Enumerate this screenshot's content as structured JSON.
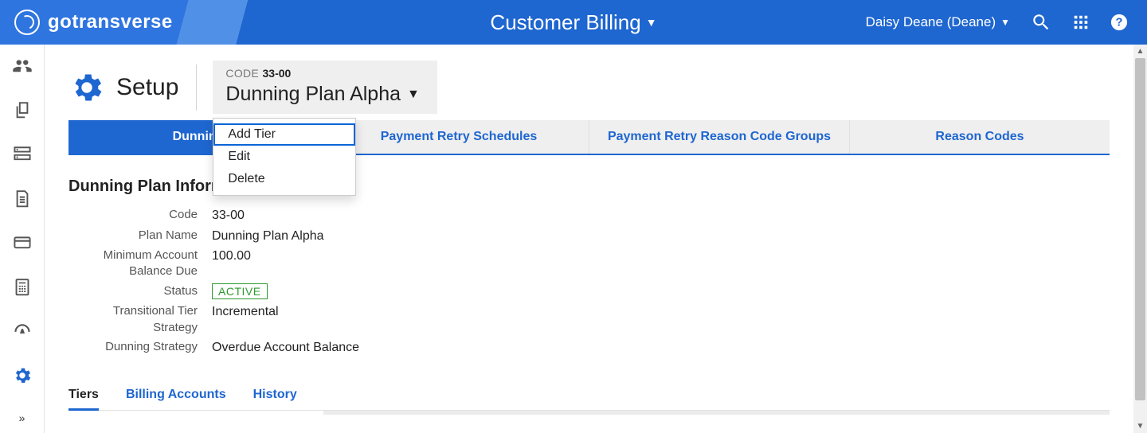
{
  "topbar": {
    "brand": "gotransverse",
    "module": "Customer Billing",
    "user": "Daisy Deane (Deane)"
  },
  "page": {
    "setup_label": "Setup",
    "code_label": "CODE",
    "code_value": "33-00",
    "plan_name": "Dunning Plan Alpha"
  },
  "plan_menu": {
    "add_tier": "Add Tier",
    "edit": "Edit",
    "delete": "Delete"
  },
  "top_tabs": {
    "dunning": "Dunning",
    "pay_retry_sched": "Payment Retry Schedules",
    "pay_retry_groups": "Payment Retry Reason Code Groups",
    "reason_codes": "Reason Codes"
  },
  "info_section": {
    "heading": "Dunning Plan Information",
    "rows": {
      "code": {
        "label": "Code",
        "value": "33-00"
      },
      "plan_name": {
        "label": "Plan Name",
        "value": "Dunning Plan Alpha"
      },
      "min_balance": {
        "label": "Minimum Account Balance Due",
        "value": "100.00"
      },
      "status": {
        "label": "Status",
        "value": "ACTIVE"
      },
      "trans_strategy": {
        "label": "Transitional Tier Strategy",
        "value": "Incremental"
      },
      "dunning_strategy": {
        "label": "Dunning Strategy",
        "value": "Overdue Account Balance"
      }
    }
  },
  "subtabs": {
    "tiers": "Tiers",
    "billing_accounts": "Billing Accounts",
    "history": "History"
  }
}
